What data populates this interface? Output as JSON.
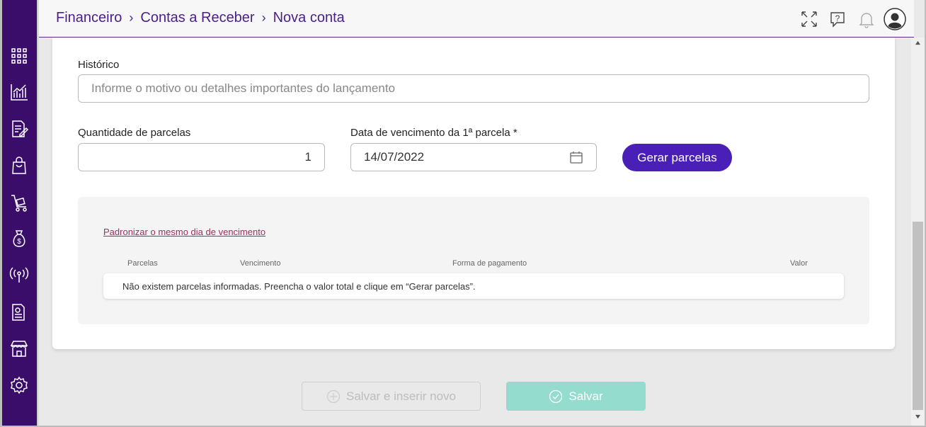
{
  "breadcrumb": {
    "level1": "Financeiro",
    "level2": "Contas a Receber",
    "level3": "Nova conta",
    "separator": "›"
  },
  "header_icons": [
    "expand-icon",
    "help-chat-icon",
    "bell-icon",
    "user-avatar-icon"
  ],
  "sidebar_icons": [
    "apps-grid-icon",
    "chart-icon",
    "document-edit-icon",
    "shopping-bag-icon",
    "cart-icon",
    "money-bag-icon",
    "broadcast-icon",
    "invoice-icon",
    "store-icon",
    "gear-icon"
  ],
  "form": {
    "historico": {
      "label": "Histórico",
      "placeholder": "Informe o motivo ou detalhes importantes do lançamento"
    },
    "quantidade": {
      "label": "Quantidade de parcelas",
      "value": "1"
    },
    "vencimento": {
      "label": "Data de vencimento da 1ª parcela *",
      "value": "14/07/2022"
    },
    "gerar_button": "Gerar parcelas"
  },
  "parcelas": {
    "link": "Padronizar o mesmo dia de vencimento",
    "columns": [
      "Parcelas",
      "Vencimento",
      "Forma de pagamento",
      "Valor"
    ],
    "empty_message": "Não existem parcelas informadas. Preencha o valor total e clique em “Gerar parcelas”."
  },
  "footer": {
    "save_new_label": "Salvar e inserir novo",
    "save_label": "Salvar"
  },
  "colors": {
    "sidebar": "#3b0d6b",
    "primary": "#4a1fb8",
    "save": "#93dcce",
    "link": "#9c2f5f"
  }
}
